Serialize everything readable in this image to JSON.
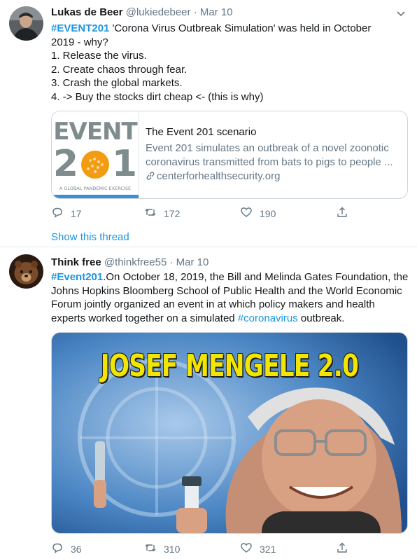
{
  "tweets": [
    {
      "name": "Lukas de Beer",
      "handle": "@lukiedebeer",
      "separator": "·",
      "date": "Mar 10",
      "text": {
        "line1_hashtag": "#EVENT201",
        "line1_rest": " 'Corona Virus Outbreak Simulation' was held in October",
        "line2": "2019 - why?",
        "line3": "1. Release the virus.",
        "line4": "2. Create chaos through fear.",
        "line5": "3. Crash the global markets.",
        "line6": "4. -> Buy the stocks dirt cheap <- (this is why)"
      },
      "card": {
        "title": "The Event 201 scenario",
        "description_line1": "Event 201 simulates an outbreak of a novel zoonotic",
        "description_line2": "coronavirus transmitted from bats to pigs to people ...",
        "domain": "centerforhealthsecurity.org",
        "thumb_word": "EVENT",
        "thumb_num_left": "2",
        "thumb_num_right": "1",
        "thumb_tagline": "A GLOBAL PANDEMIC EXERCISE"
      },
      "actions": {
        "replies": "17",
        "retweets": "172",
        "likes": "190"
      },
      "show_thread": "Show this thread"
    },
    {
      "name": "Think free",
      "handle": "@thinkfree55",
      "separator": "·",
      "date": "Mar 10",
      "text": {
        "line1_hashtag": "#Event201",
        "line1_rest": ".On October 18, 2019, the Bill and Melinda Gates Foundation, the",
        "line2": "Johns Hopkins Bloomberg School of Public Health and the World Economic",
        "line3": "Forum jointly organized an event in at which policy makers and health",
        "line4_start": "experts worked together on a simulated ",
        "line4_hashtag": "#coronavirus",
        "line4_end": " outbreak."
      },
      "media": {
        "caption": "JOSEF MENGELE 2.0"
      },
      "actions": {
        "replies": "36",
        "retweets": "310",
        "likes": "321"
      }
    }
  ],
  "colors": {
    "link": "#1b95e0",
    "muted": "#657786",
    "text": "#14171a",
    "border": "#ccd6dd",
    "thumb_orange": "#f39c12",
    "thumb_gray": "#7f8c8d"
  },
  "icons": [
    "reply-icon",
    "retweet-icon",
    "like-icon",
    "share-icon",
    "caret-down-icon",
    "link-icon"
  ]
}
